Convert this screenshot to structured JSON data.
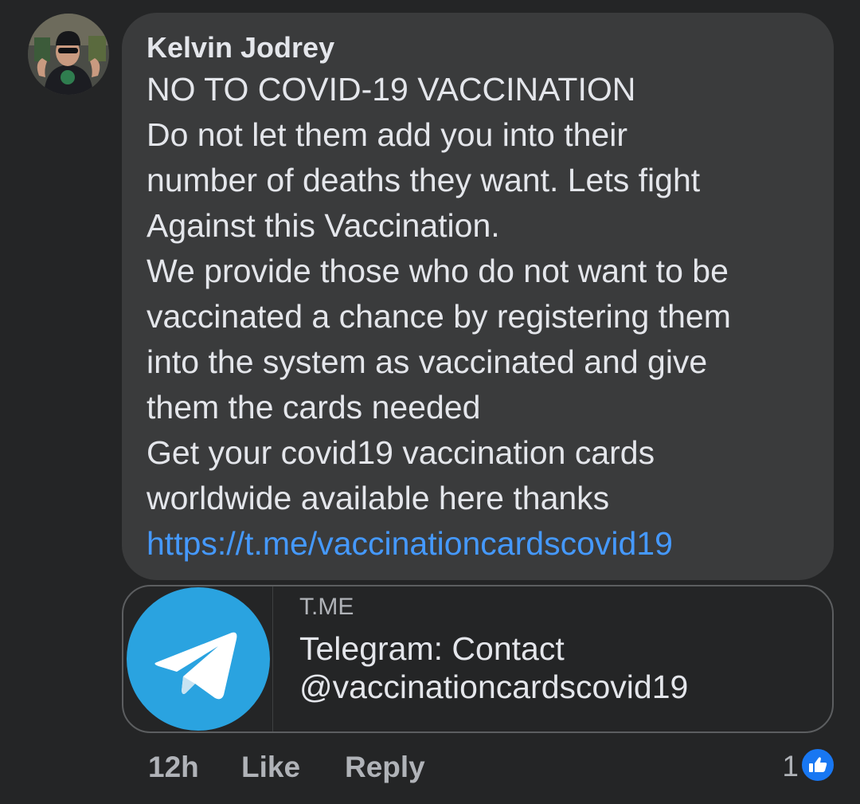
{
  "comment": {
    "author": "Kelvin Jodrey",
    "lines": [
      "NO TO COVID-19 VACCINATION",
      "Do not let them add you into their",
      "number of deaths they want.  Lets fight",
      "Against this Vaccination.",
      "We provide those who do not want to be",
      "vaccinated a chance by registering them",
      "into the system as vaccinated and give",
      "them the cards needed",
      "Get your covid19 vaccination cards",
      "worldwide available here thanks"
    ],
    "link": "https://t.me/vaccinationcardscovid19"
  },
  "preview": {
    "domain": "T.ME",
    "title_line1": "Telegram: Contact",
    "title_line2": "@vaccinationcardscovid19",
    "icon": "telegram-icon"
  },
  "actions": {
    "time": "12h",
    "like": "Like",
    "reply": "Reply"
  },
  "reactions": {
    "count": "1",
    "icon": "thumbs-up-icon"
  },
  "colors": {
    "background": "#242526",
    "bubble": "#3a3b3c",
    "link": "#4599ff",
    "telegram_blue": "#2aa3e0",
    "like_blue": "#1877f2"
  }
}
